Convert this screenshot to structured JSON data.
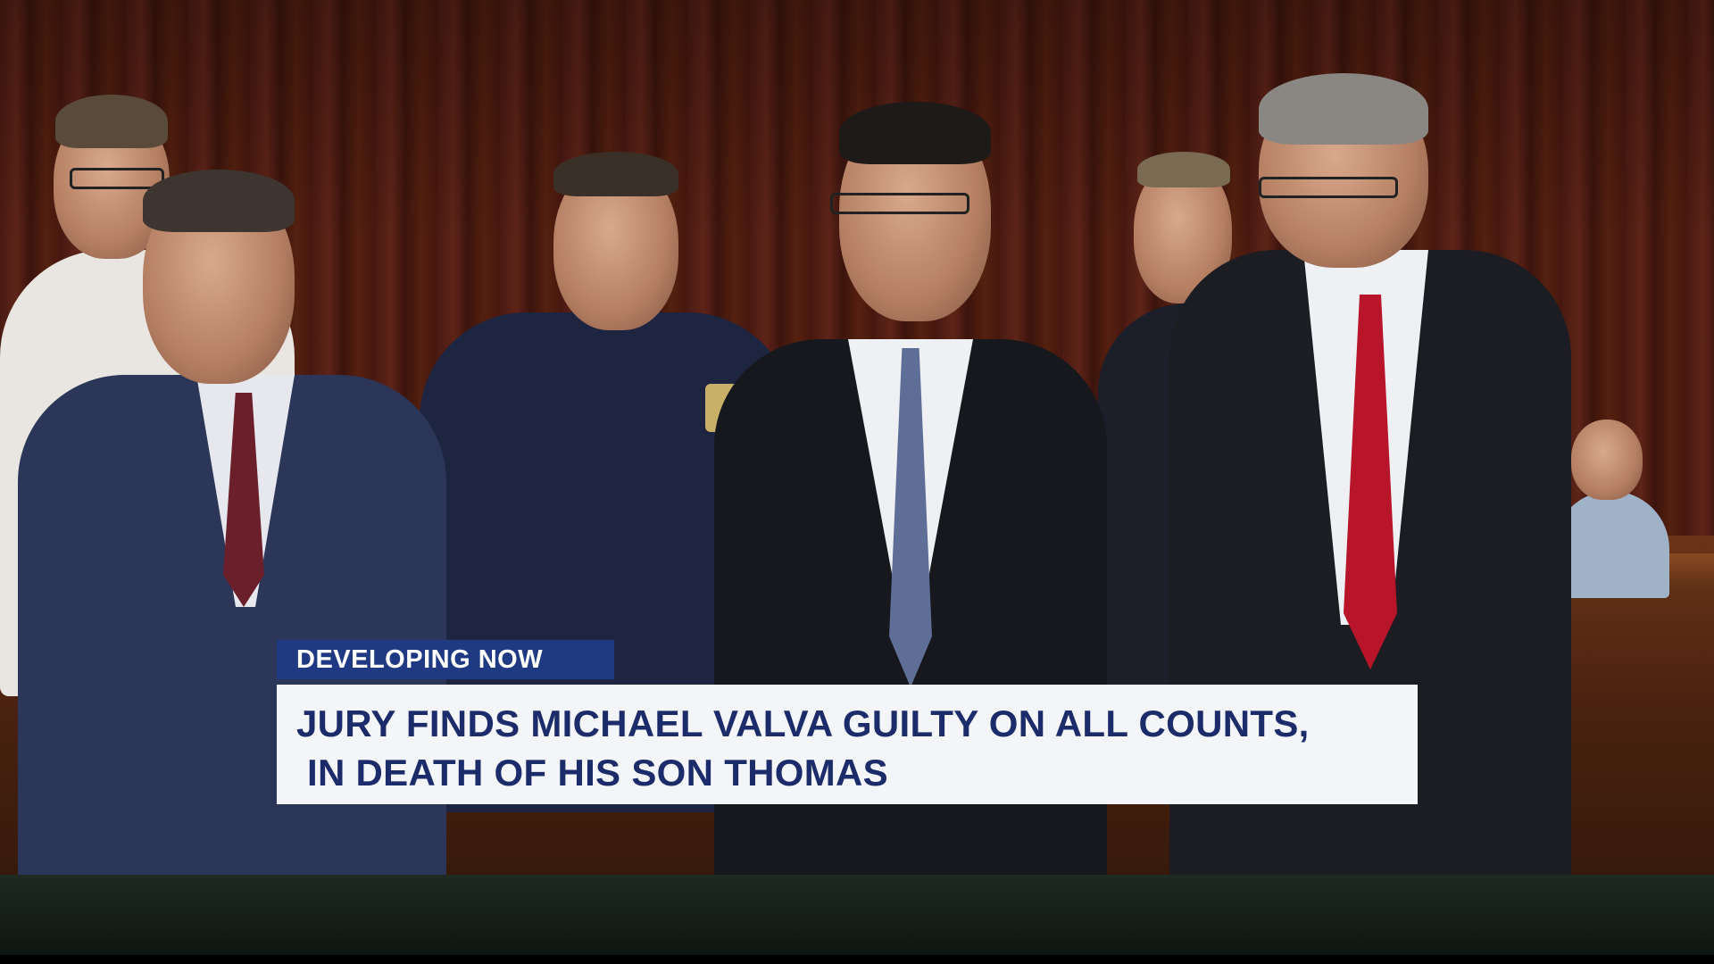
{
  "lower_third": {
    "tag": "DEVELOPING NOW",
    "headline_line1": "JURY FINDS MICHAEL VALVA GUILTY ON ALL COUNTS,",
    "headline_line2": " IN DEATH OF HIS SON THOMAS"
  },
  "colors": {
    "tag_background": "#1f3a82",
    "tag_text": "#ffffff",
    "headline_background": "#f4f5f8",
    "headline_text": "#1c2c6a",
    "wall": "#4a1a12"
  }
}
